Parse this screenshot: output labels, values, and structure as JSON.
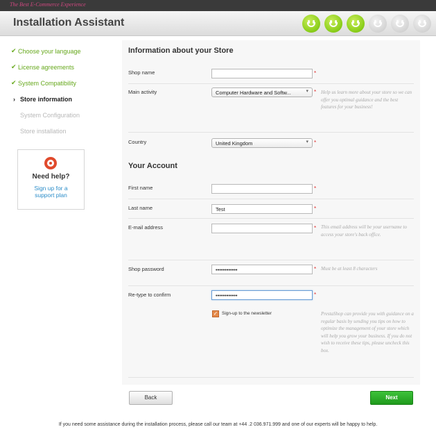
{
  "app": {
    "tagline": "The Best E-Commerce Experience",
    "title": "Installation Assistant"
  },
  "progress": {
    "completed_steps": 3,
    "total_steps": 6
  },
  "sidebar": {
    "steps": [
      {
        "label": "Choose your language",
        "state": "done",
        "mark": "✔"
      },
      {
        "label": "License agreements",
        "state": "done",
        "mark": "✔"
      },
      {
        "label": "System Compatibility",
        "state": "done",
        "mark": "✔"
      },
      {
        "label": "Store information",
        "state": "current",
        "mark": "›"
      },
      {
        "label": "System Configuration",
        "state": "todo",
        "mark": ""
      },
      {
        "label": "Store installation",
        "state": "todo",
        "mark": ""
      }
    ],
    "help": {
      "title": "Need help?",
      "link": "Sign up for a support plan"
    }
  },
  "store": {
    "section_title": "Information about your Store",
    "shop_name": {
      "label": "Shop name",
      "value": ""
    },
    "main_activity": {
      "label": "Main activity",
      "value": "Computer Hardware and Softw...",
      "hint": "Help us learn more about your store so we can offer you optimal guidance and the best features for your business!"
    },
    "country": {
      "label": "Country",
      "value": "United Kingdom"
    }
  },
  "account": {
    "section_title": "Your Account",
    "first_name": {
      "label": "First name",
      "value": ""
    },
    "last_name": {
      "label": "Last name",
      "value": "Test"
    },
    "email": {
      "label": "E-mail address",
      "value": "",
      "hint": "This email address will be your username to access your store's back office."
    },
    "password": {
      "label": "Shop password",
      "value": "••••••••••••",
      "hint": "Must be at least 8 characters"
    },
    "confirm": {
      "label": "Re-type to confirm",
      "value": "••••••••••••"
    },
    "newsletter": {
      "label": "Sign-up to the newsletter",
      "checked": true,
      "hint": "PrestaShop can provide you with guidance on a regular basis by sending you tips on how to optimize the management of your store which will help you grow your business. If you do not wish to receive these tips, please uncheck this box."
    }
  },
  "required_mark": "*",
  "buttons": {
    "back": "Back",
    "next": "Next"
  },
  "footer": "If you need some assistance during the installation process, please call our team at +44 .2 036.971.999 and one of our experts will be happy to help.",
  "colors": {
    "accent_green": "#66a81c",
    "next_button": "#2aab27",
    "link": "#2a8cc8",
    "required": "#e03030"
  }
}
